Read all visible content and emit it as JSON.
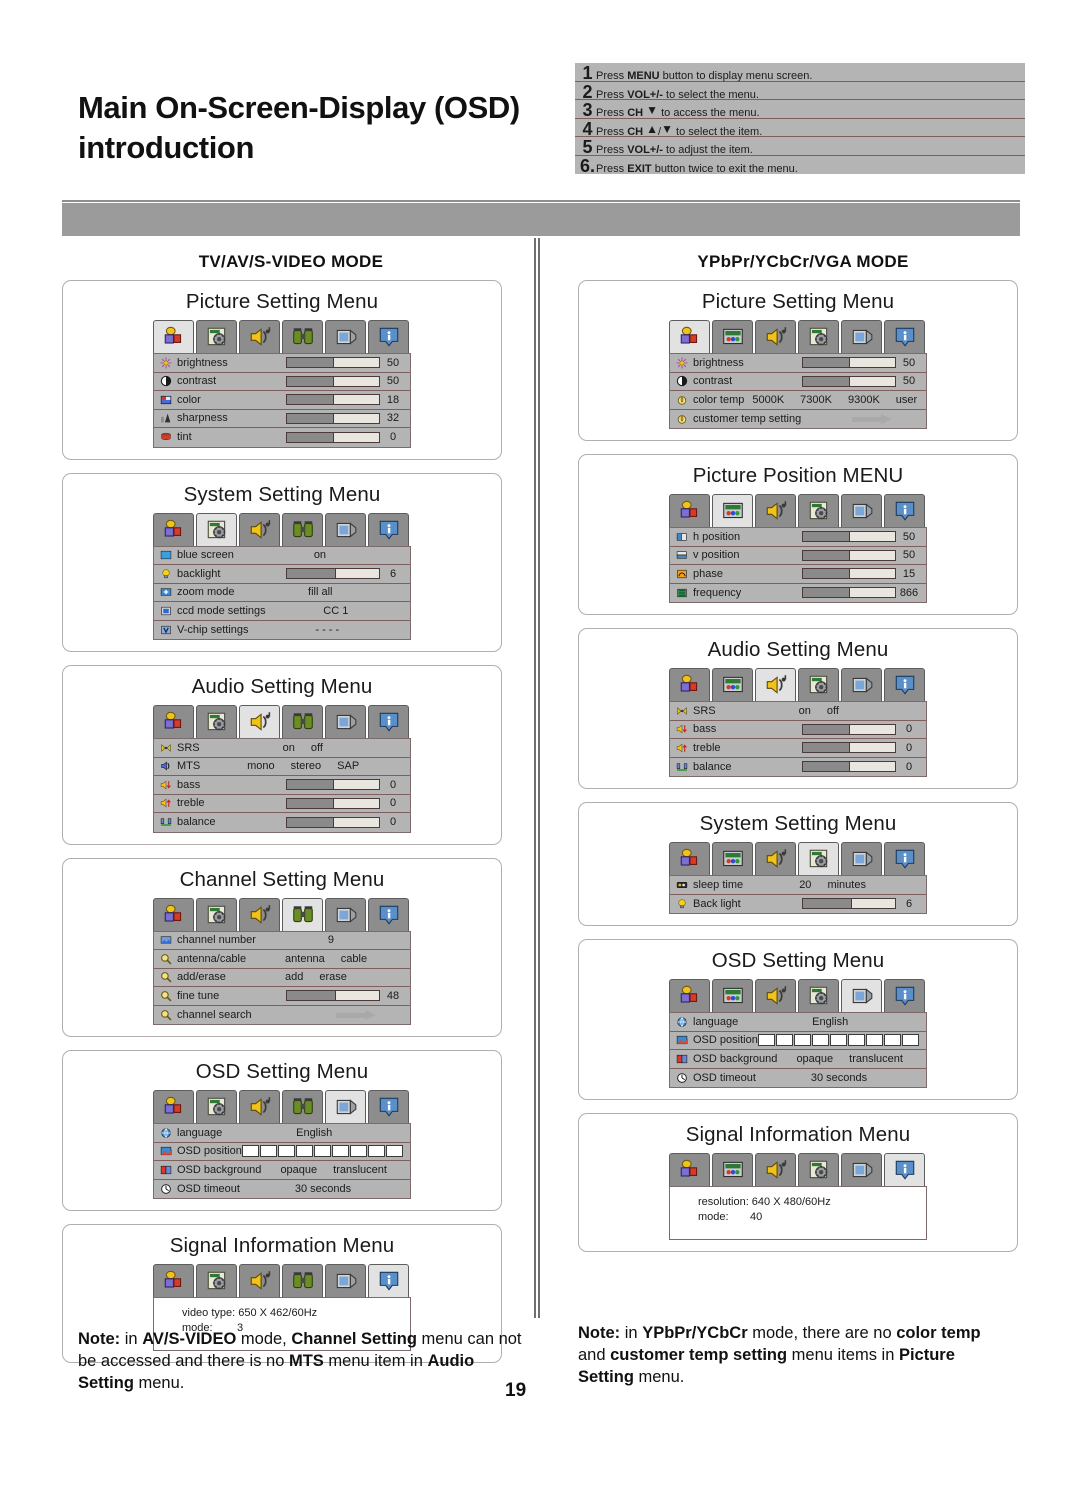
{
  "header": {
    "title_line1": "Main On-Screen-Display (OSD)",
    "title_line2": "introduction",
    "steps": [
      {
        "num": "1",
        "pre": "Press ",
        "key": "MENU",
        "post": " button to display menu screen."
      },
      {
        "num": "2",
        "pre": "Press ",
        "key": "VOL+/-",
        "post": " to select the menu."
      },
      {
        "num": "3",
        "pre": "Press ",
        "key": "CH",
        "arrows": "down",
        "post": " to access the menu."
      },
      {
        "num": "4",
        "pre": "Press ",
        "key": "CH",
        "arrows": "up-down",
        "post": " to select the item."
      },
      {
        "num": "5",
        "pre": "Press ",
        "key": "VOL+/-",
        "post": " to adjust the item."
      },
      {
        "num": "6.",
        "pre": "Press ",
        "key": "EXIT",
        "post": " button twice to exit the menu."
      }
    ]
  },
  "columns": {
    "left": {
      "mode_label": "TV/AV/S-VIDEO MODE",
      "tab_icons": [
        "picture-blocks-icon",
        "system-gear-icon",
        "audio-speaker-icon",
        "channel-binoculars-icon",
        "osd-monitor-icon",
        "info-icon"
      ],
      "cards": [
        {
          "caption": "Picture Setting Menu",
          "selected_tab": 0,
          "rows": [
            {
              "icon": "brightness-sun-icon",
              "label": "brightness",
              "type": "slider",
              "fill": 50,
              "value": "50"
            },
            {
              "icon": "contrast-circle-icon",
              "label": "contrast",
              "type": "slider",
              "fill": 50,
              "value": "50"
            },
            {
              "icon": "color-tv-icon",
              "label": "color",
              "type": "slider",
              "fill": 50,
              "value": "18"
            },
            {
              "icon": "sharpness-icon",
              "label": "sharpness",
              "type": "slider",
              "fill": 50,
              "value": "32"
            },
            {
              "icon": "tint-icon",
              "label": "tint",
              "type": "slider",
              "fill": 50,
              "value": "0"
            }
          ]
        },
        {
          "caption": "System Setting Menu",
          "selected_tab": 1,
          "rows": [
            {
              "icon": "blue-screen-icon",
              "label": "blue screen",
              "type": "options",
              "options": [
                "on"
              ]
            },
            {
              "icon": "backlight-bulb-icon",
              "label": "backlight",
              "type": "slider",
              "fill": 52,
              "value": "6"
            },
            {
              "icon": "zoom-mode-icon",
              "label": "zoom mode",
              "type": "options",
              "options": [
                "fill all"
              ]
            },
            {
              "icon": "ccd-mode-icon",
              "label": "ccd mode settings",
              "type": "options",
              "options": [
                "CC 1"
              ]
            },
            {
              "icon": "vchip-icon",
              "label": "V-chip settings",
              "type": "options",
              "options": [
                "- - - -"
              ]
            }
          ]
        },
        {
          "caption": "Audio Setting Menu",
          "selected_tab": 2,
          "rows": [
            {
              "icon": "srs-icon",
              "label": "SRS",
              "type": "options",
              "options": [
                "on",
                "off"
              ]
            },
            {
              "icon": "mts-icon",
              "label": "MTS",
              "type": "options",
              "options": [
                "mono",
                "stereo",
                "SAP"
              ]
            },
            {
              "icon": "bass-icon",
              "label": "bass",
              "type": "slider",
              "fill": 50,
              "value": "0"
            },
            {
              "icon": "treble-icon",
              "label": "treble",
              "type": "slider",
              "fill": 50,
              "value": "0"
            },
            {
              "icon": "balance-icon",
              "label": "balance",
              "type": "slider",
              "fill": 50,
              "value": "0"
            }
          ]
        },
        {
          "caption": "Channel Setting Menu",
          "selected_tab": 3,
          "rows": [
            {
              "icon": "channel-number-icon",
              "label": "channel number",
              "type": "options",
              "options": [
                "9"
              ]
            },
            {
              "icon": "magnifier-icon",
              "label": "antenna/cable",
              "type": "options",
              "options": [
                "antenna",
                "cable"
              ]
            },
            {
              "icon": "magnifier-icon",
              "label": "add/erase",
              "type": "options",
              "options": [
                "add",
                "erase"
              ]
            },
            {
              "icon": "magnifier-icon",
              "label": "fine tune",
              "type": "slider",
              "fill": 52,
              "value": "48"
            },
            {
              "icon": "magnifier-icon",
              "label": "channel search",
              "type": "arrow"
            }
          ]
        },
        {
          "caption": "OSD Setting Menu",
          "selected_tab": 4,
          "rows": [
            {
              "icon": "language-globe-icon",
              "label": "language",
              "type": "options",
              "options": [
                "English"
              ]
            },
            {
              "icon": "osd-position-icon",
              "label": "OSD position",
              "type": "chips",
              "chips": 9
            },
            {
              "icon": "osd-background-icon",
              "label": "OSD background",
              "type": "options",
              "options": [
                "opaque",
                "translucent"
              ]
            },
            {
              "icon": "osd-timeout-clock-icon",
              "label": "OSD timeout",
              "type": "options",
              "options": [
                "30 seconds"
              ]
            }
          ]
        },
        {
          "caption": "Signal Information Menu",
          "selected_tab": 5,
          "info": [
            "video type: 650 X 462/60Hz",
            "mode:        3"
          ]
        }
      ]
    },
    "right": {
      "mode_label": "YPbPr/YCbCr/VGA MODE",
      "tab_icons": [
        "picture-blocks-icon",
        "picture-position-icon",
        "audio-speaker-icon",
        "system-gear-icon",
        "osd-monitor-icon",
        "info-icon"
      ],
      "cards": [
        {
          "caption": "Picture Setting Menu",
          "selected_tab": 0,
          "rows": [
            {
              "icon": "brightness-sun-icon",
              "label": "brightness",
              "type": "slider",
              "fill": 50,
              "value": "50"
            },
            {
              "icon": "contrast-circle-icon",
              "label": "contrast",
              "type": "slider",
              "fill": 50,
              "value": "50"
            },
            {
              "icon": "color-temp-icon",
              "label": "color temp",
              "type": "options",
              "options": [
                "5000K",
                "7300K",
                "9300K",
                "user"
              ]
            },
            {
              "icon": "color-temp-icon",
              "label": "customer temp setting",
              "type": "arrow"
            }
          ]
        },
        {
          "caption": "Picture Position MENU",
          "selected_tab": 1,
          "rows": [
            {
              "icon": "h-position-icon",
              "label": "h position",
              "type": "slider",
              "fill": 50,
              "value": "50"
            },
            {
              "icon": "v-position-icon",
              "label": "v position",
              "type": "slider",
              "fill": 50,
              "value": "50"
            },
            {
              "icon": "phase-icon",
              "label": "phase",
              "type": "slider",
              "fill": 50,
              "value": "15"
            },
            {
              "icon": "frequency-icon",
              "label": "frequency",
              "type": "slider",
              "fill": 50,
              "value": "866"
            }
          ]
        },
        {
          "caption": "Audio Setting Menu",
          "selected_tab": 2,
          "rows": [
            {
              "icon": "srs-icon",
              "label": "SRS",
              "type": "options",
              "options": [
                "on",
                "off"
              ]
            },
            {
              "icon": "bass-icon",
              "label": "bass",
              "type": "slider",
              "fill": 50,
              "value": "0"
            },
            {
              "icon": "treble-icon",
              "label": "treble",
              "type": "slider",
              "fill": 50,
              "value": "0"
            },
            {
              "icon": "balance-icon",
              "label": "balance",
              "type": "slider",
              "fill": 50,
              "value": "0"
            }
          ]
        },
        {
          "caption": "System Setting Menu",
          "selected_tab": 3,
          "rows": [
            {
              "icon": "sleep-time-icon",
              "label": "sleep time",
              "type": "options",
              "options": [
                "20",
                "minutes"
              ]
            },
            {
              "icon": "backlight-bulb-icon",
              "label": "Back light",
              "type": "slider",
              "fill": 52,
              "value": "6"
            }
          ]
        },
        {
          "caption": "OSD Setting Menu",
          "selected_tab": 4,
          "rows": [
            {
              "icon": "language-globe-icon",
              "label": "language",
              "type": "options",
              "options": [
                "English"
              ]
            },
            {
              "icon": "osd-position-icon",
              "label": "OSD position",
              "type": "chips",
              "chips": 9
            },
            {
              "icon": "osd-background-icon",
              "label": "OSD background",
              "type": "options",
              "options": [
                "opaque",
                "translucent"
              ]
            },
            {
              "icon": "osd-timeout-clock-icon",
              "label": "OSD timeout",
              "type": "options",
              "options": [
                "30 seconds"
              ]
            }
          ]
        },
        {
          "caption": "Signal Information Menu",
          "selected_tab": 5,
          "info": [
            "resolution: 640 X 480/60Hz",
            "mode:       40"
          ]
        }
      ]
    }
  },
  "notes": {
    "left_html": "<b>Note:</b> in <b>AV/S-VIDEO</b> mode, <b>Channel Setting</b> menu can not be accessed and there is no <b>MTS</b> menu item in <b>Audio Setting</b> menu.",
    "right_html": "<b>Note:</b> in <b>YPbPr/YCbCr</b> mode, there are no <b>color temp</b> and <b>customer temp setting</b> menu items in <b>Picture Setting</b> menu."
  },
  "page_number": "19",
  "colors": {
    "header_bar": "#9b9b9b",
    "osd_row_bg": "#b4b4b4",
    "osd_row_border": "#7d5f5f",
    "tab_bg": "#8d8d8d",
    "tab_selected_bg": "#e2e2e2",
    "slider_fill": "#8a8a8a",
    "slider_track": "#e9e6e0"
  }
}
